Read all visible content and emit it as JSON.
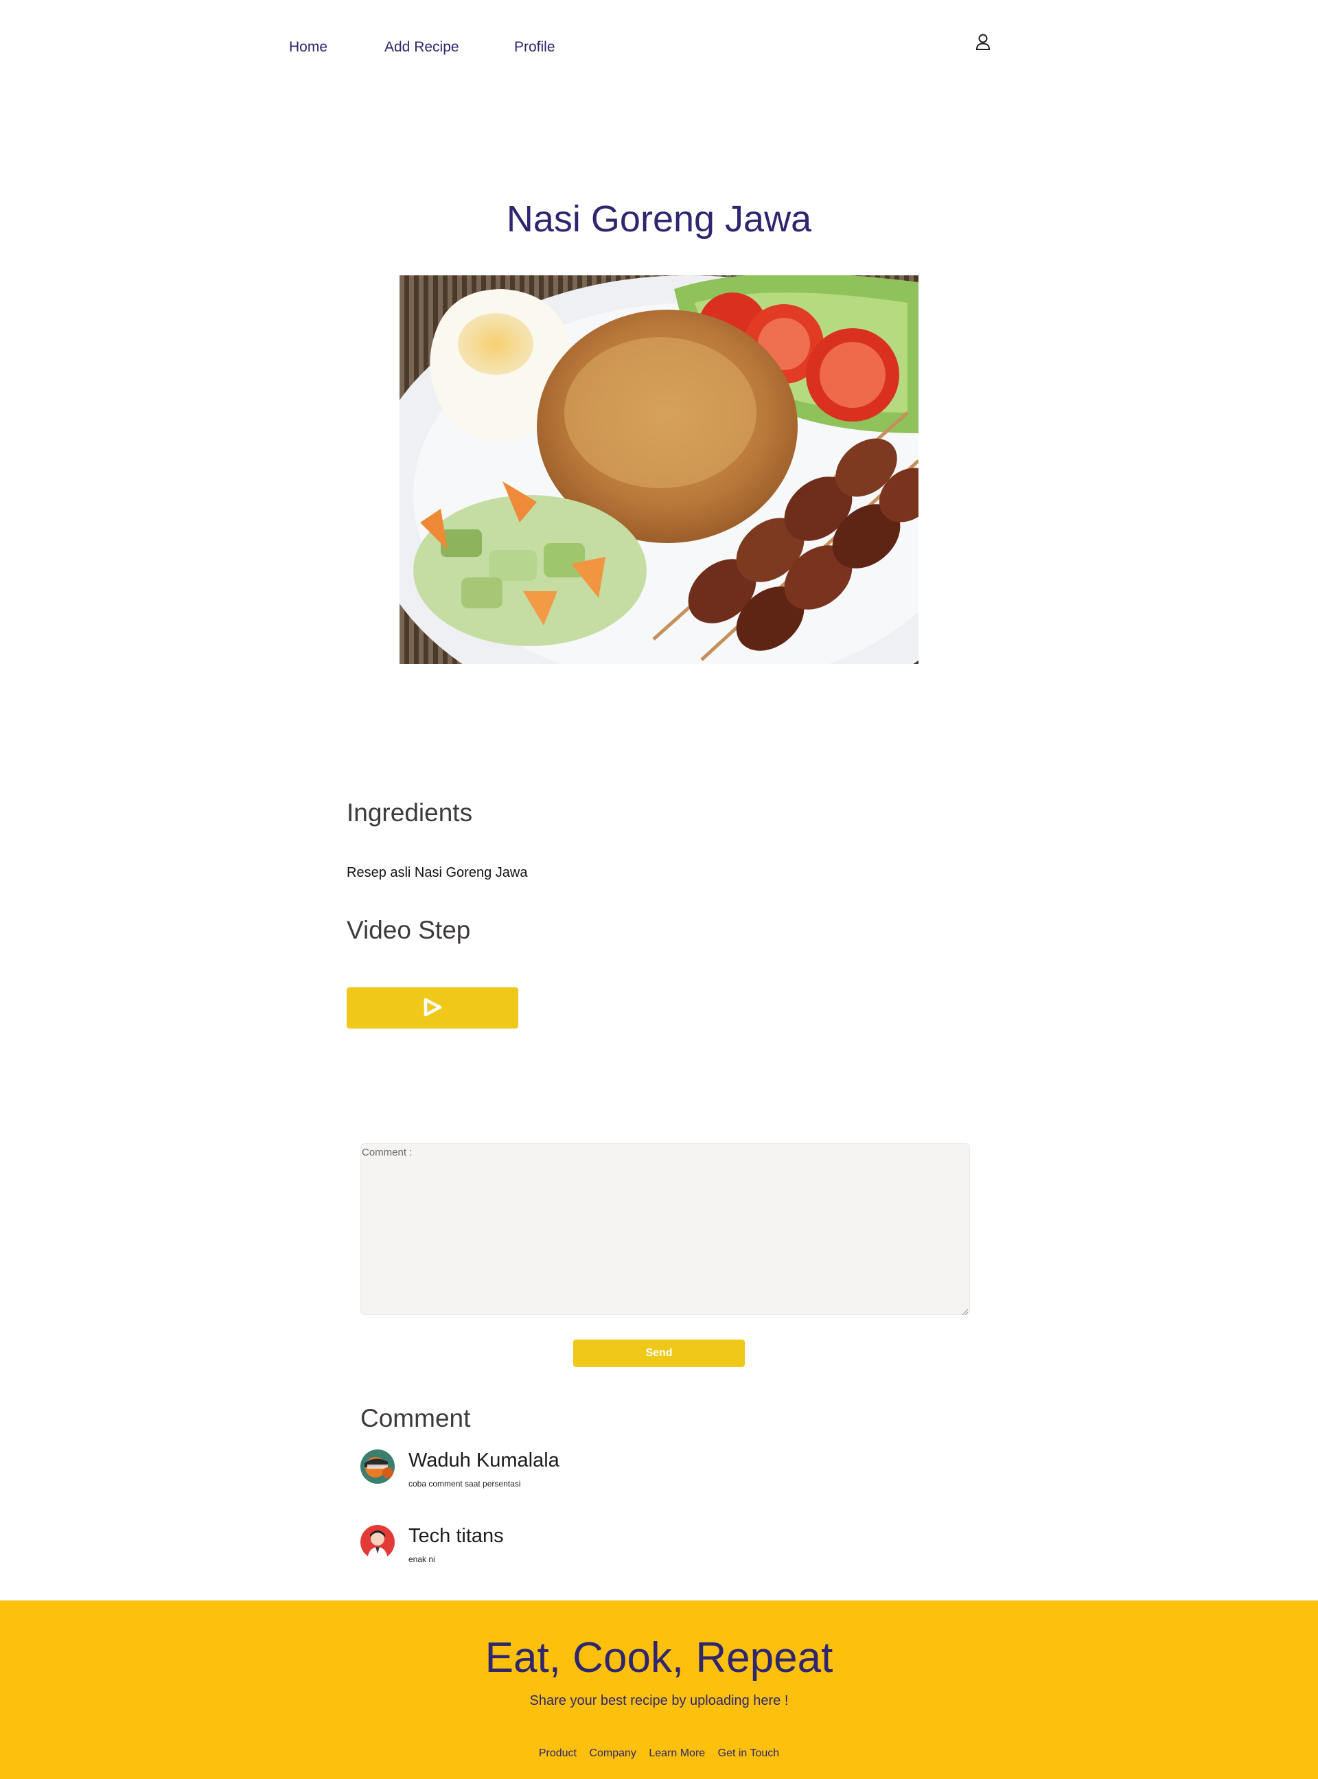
{
  "nav": {
    "links": [
      "Home",
      "Add Recipe",
      "Profile"
    ]
  },
  "recipe": {
    "title": "Nasi Goreng Jawa",
    "ingredients_heading": "Ingredients",
    "ingredients_text": "Resep asli Nasi Goreng Jawa",
    "video_heading": "Video Step"
  },
  "comment_form": {
    "label": "Comment :",
    "value": "",
    "send_label": "Send"
  },
  "comments": {
    "heading": "Comment",
    "items": [
      {
        "name": "Waduh Kumalala",
        "text": "coba comment saat persentasi"
      },
      {
        "name": "Tech titans",
        "text": "enak ni"
      }
    ]
  },
  "footer": {
    "title": "Eat, Cook, Repeat",
    "subtitle": "Share your best recipe by uploading here !",
    "links": [
      "Product",
      "Company",
      "Learn More",
      "Get in Touch"
    ]
  },
  "icons": {
    "user": "user-icon",
    "play": "play-icon"
  },
  "colors": {
    "brand_navy": "#2e266f",
    "accent_yellow": "#efc81a",
    "footer_yellow": "#fcc00d"
  }
}
